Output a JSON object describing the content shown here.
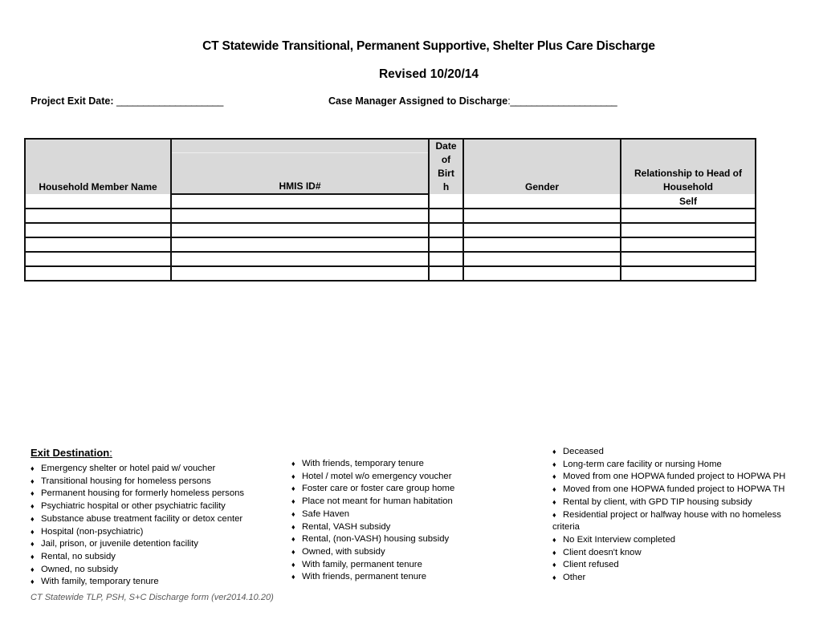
{
  "document": {
    "title": "CT Statewide Transitional, Permanent Supportive, Shelter Plus Care Discharge",
    "revised": "Revised 10/20/14"
  },
  "fields": {
    "project_exit_date": {
      "label": "Project Exit Date:",
      "value": "____________________"
    },
    "case_manager": {
      "label": "Case Manager Assigned to Discharge",
      "colon": ":",
      "value": "____________________"
    }
  },
  "household_table": {
    "columns": [
      "Household Member Name",
      "HMIS ID#",
      "Date of Birt h",
      "Gender",
      "Relationship to Head of Household"
    ],
    "dob_header_lines": [
      "Date",
      "of",
      "Birt",
      "h"
    ],
    "relationship_header_lines": [
      "Relationship to Head of",
      "Household"
    ],
    "rows": [
      [
        "",
        "",
        "",
        "",
        "Self"
      ],
      [
        "",
        "",
        "",
        "",
        ""
      ],
      [
        "",
        "",
        "",
        "",
        ""
      ],
      [
        "",
        "",
        "",
        "",
        ""
      ],
      [
        "",
        "",
        "",
        "",
        ""
      ],
      [
        "",
        "",
        "",
        "",
        ""
      ]
    ]
  },
  "exit_destination": {
    "title": "Exit Destination",
    "title_suffix": ":",
    "bullet": "♦",
    "left_column": [
      "Emergency shelter or hotel paid w/ voucher",
      "Transitional housing for homeless persons",
      "Permanent housing for formerly homeless persons",
      "Psychiatric hospital or other psychiatric facility",
      "Substance abuse treatment facility or detox center",
      "Hospital (non-psychiatric)",
      "Jail, prison, or juvenile detention facility",
      "Rental, no subsidy",
      "Owned, no subsidy",
      "With family, temporary tenure"
    ],
    "middle_column": [
      "With friends, temporary tenure",
      "Hotel / motel w/o emergency voucher",
      "Foster care or foster care group home",
      "Place not meant for human habitation",
      "Safe Haven",
      "Rental, VASH subsidy",
      "Rental, (non-VASH) housing subsidy",
      "Owned, with subsidy",
      "With family, permanent tenure",
      "With friends, permanent tenure"
    ],
    "right_column": [
      "Deceased",
      "Long-term care facility or nursing Home",
      "Moved from one HOPWA funded project to HOPWA PH",
      "Moved from one HOPWA funded project to HOPWA TH",
      "Rental by client, with GPD TIP housing subsidy",
      "Residential project or halfway house with no homeless",
      "criteria",
      "No Exit Interview completed",
      "Client doesn't know",
      "Client refused",
      "Other"
    ]
  },
  "footer": "CT Statewide TLP, PSH, S+C  Discharge form (ver2014.10.20)"
}
